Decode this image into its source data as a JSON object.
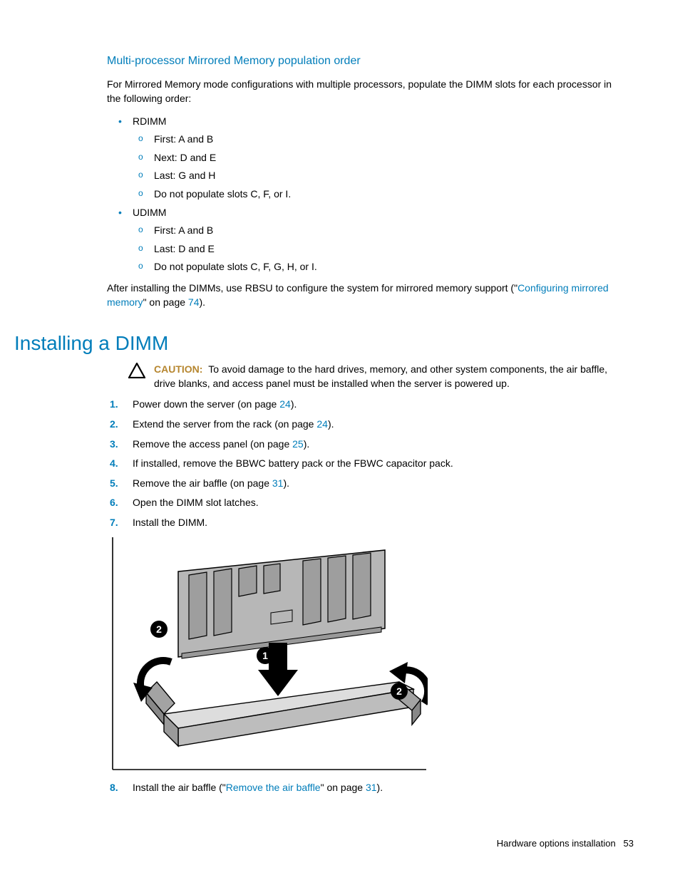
{
  "subheading": "Multi-processor Mirrored Memory population order",
  "intro": "For Mirrored Memory mode configurations with multiple processors, populate the DIMM slots for each processor in the following order:",
  "rdimm": {
    "label": "RDIMM",
    "items": [
      "First: A and B",
      "Next: D and E",
      "Last: G and H",
      "Do not populate slots C, F, or I."
    ]
  },
  "udimm": {
    "label": "UDIMM",
    "items": [
      "First: A and B",
      "Last: D and E",
      "Do not populate slots C, F, G, H, or I."
    ]
  },
  "after_install_pre": "After installing the DIMMs, use RBSU to configure the system for mirrored memory support (\"",
  "after_install_link": "Configuring mirrored memory",
  "after_install_mid": "\" on page ",
  "after_install_page": "74",
  "after_install_post": ").",
  "section_title": "Installing a DIMM",
  "caution_label": "CAUTION:",
  "caution_text": "To avoid damage to the hard drives, memory, and other system components, the air baffle, drive blanks, and access panel must be installed when the server is powered up.",
  "steps": {
    "s1_pre": "Power down the server (on page ",
    "s1_page": "24",
    "s1_post": ").",
    "s2_pre": "Extend the server from the rack (on page ",
    "s2_page": "24",
    "s2_post": ").",
    "s3_pre": "Remove the access panel (on page ",
    "s3_page": "25",
    "s3_post": ").",
    "s4": "If installed, remove the BBWC battery pack or the FBWC capacitor pack.",
    "s5_pre": "Remove the air baffle (on page ",
    "s5_page": "31",
    "s5_post": ").",
    "s6": "Open the DIMM slot latches.",
    "s7": "Install the DIMM.",
    "s8_pre": "Install the air baffle (\"",
    "s8_link": "Remove the air baffle",
    "s8_mid": "\" on page ",
    "s8_page": "31",
    "s8_post": ")."
  },
  "footer_text": "Hardware options installation",
  "footer_page": "53"
}
